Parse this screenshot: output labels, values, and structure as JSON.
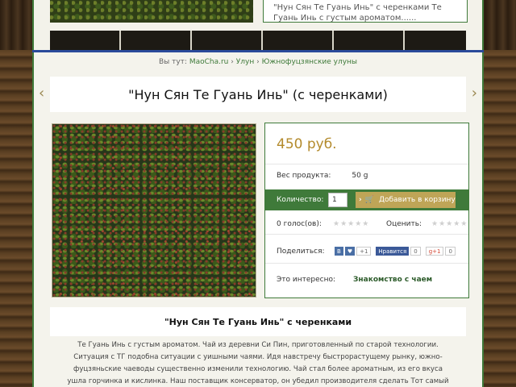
{
  "top_snippet": {
    "text": "\"Нун Сян Те Гуань Инь\" с черенками Те Гуань Инь с густым ароматом......"
  },
  "breadcrumb": {
    "prefix": "Вы тут:",
    "items": [
      "MaoCha.ru",
      "Улун",
      "Южнофуцзянские улуны"
    ],
    "separator": "›"
  },
  "product": {
    "title": "\"Нун Сян Те Гуань Инь\" (с черенками)",
    "price": "450 руб.",
    "weight_label": "Вес продукта:",
    "weight_value": "50 g",
    "qty_label": "Количество:",
    "qty_value": "1",
    "add_to_cart": "Добавить в корзину",
    "votes_label": "0 голос(ов):",
    "rate_label": "Оценить:",
    "share_label": "Поделиться:",
    "interesting_label": "Это интересно:",
    "interesting_link": "Знакомство с чаем"
  },
  "social": {
    "vk_label": "B",
    "vk_count": "+1",
    "fb_label": "Нравится",
    "fb_count": "0",
    "gp_label": "g+1",
    "gp_count": "0"
  },
  "description": {
    "title": "\"Нун Сян Те Гуань Инь\" с черенками",
    "text": "Те Гуань Инь с густым ароматом. Чай из деревни Си Пин, приготовленный по старой технологии. Ситуация с ТГ подобна ситуации с уишными чаями. Идя навстречу быстрорастущему рынку, южно-фуцзяньские чаеводы существенно изменили технологию. Чай стал более ароматным, из его вкуса ушла горчинка и кислинка. Наш поставщик  консерватор, он убедил производителя сделать Тот самый ТГ, как десять лет назад. Большой лист, более"
  },
  "icons": {
    "nav_prev": "‹",
    "nav_next": "›",
    "chevron": "›",
    "cart": "🛒",
    "stars": "★★★★★"
  },
  "colors": {
    "accent_green": "#3f7a3a",
    "price_gold": "#b38a2c",
    "button_gold": "#bfa557"
  }
}
